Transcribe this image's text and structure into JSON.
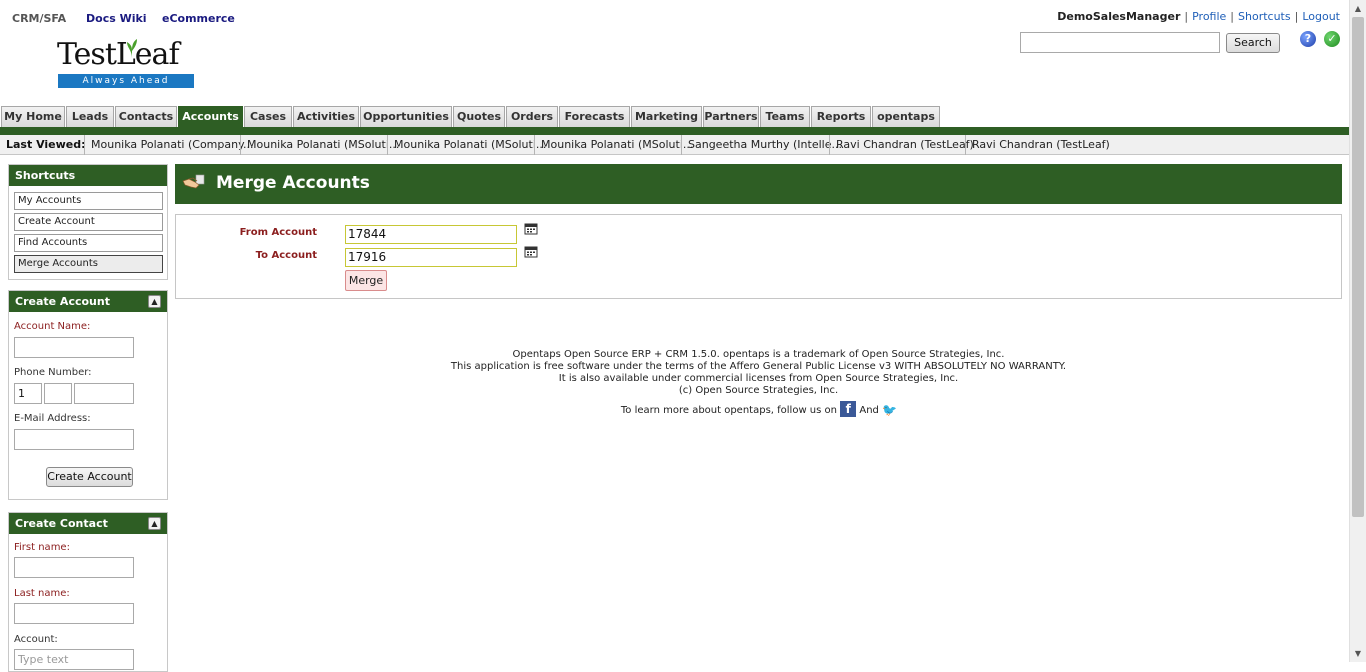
{
  "top_links": {
    "crm": "CRM/SFA",
    "docs": "Docs Wiki",
    "ecommerce": "eCommerce"
  },
  "logo": {
    "tagline": "Always Ahead",
    "text": "TestLeaf"
  },
  "user_nav": {
    "user": "DemoSalesManager",
    "profile": "Profile",
    "shortcuts": "Shortcuts",
    "logout": "Logout",
    "separator": "|"
  },
  "search": {
    "button": "Search",
    "value": ""
  },
  "tabs": [
    "My Home",
    "Leads",
    "Contacts",
    "Accounts",
    "Cases",
    "Activities",
    "Opportunities",
    "Quotes",
    "Orders",
    "Forecasts",
    "Marketing",
    "Partners",
    "Teams",
    "Reports",
    "opentaps"
  ],
  "active_tab": "Accounts",
  "last_viewed": {
    "label": "Last Viewed:",
    "items": [
      "Mounika Polanati (Company...",
      "Mounika Polanati (MSoluti...",
      "Mounika Polanati (MSoluti...",
      "Mounika Polanati (MSoluti...",
      "Sangeetha Murthy (Intelle...",
      "Ravi Chandran (TestLeaf)",
      "Ravi Chandran (TestLeaf)"
    ]
  },
  "shortcuts": {
    "title": "Shortcuts",
    "items": [
      "My Accounts",
      "Create Account",
      "Find Accounts",
      "Merge Accounts"
    ],
    "active": "Merge Accounts"
  },
  "create_account": {
    "title": "Create Account",
    "account_name_label": "Account Name:",
    "phone_label": "Phone Number:",
    "phone_country": "1",
    "email_label": "E-Mail Address:",
    "button": "Create Account"
  },
  "create_contact": {
    "title": "Create Contact",
    "first_name_label": "First name:",
    "last_name_label": "Last name:",
    "account_label": "Account:",
    "account_placeholder": "Type text"
  },
  "merge": {
    "title": "Merge Accounts",
    "from_label": "From Account",
    "from_value": "17844",
    "to_label": "To Account",
    "to_value": "17916",
    "button": "Merge"
  },
  "footer": {
    "line1": "Opentaps Open Source ERP + CRM 1.5.0. opentaps is a trademark of Open Source Strategies, Inc.",
    "line2": "This application is free software under the terms of the Affero General Public License v3 WITH ABSOLUTELY NO WARRANTY.",
    "line3": "It is also available under commercial licenses from Open Source Strategies, Inc.",
    "line4": "(c) Open Source Strategies, Inc.",
    "follow_text": "To learn more about opentaps, follow us on",
    "and_text": "And",
    "facebook_glyph": "f",
    "twitter_glyph": "🐦"
  },
  "colors": {
    "brand_green": "#2e5e24",
    "required_red": "#8b1e1e",
    "link_blue": "#1f5fb8",
    "logo_blue": "#1b78c2"
  }
}
